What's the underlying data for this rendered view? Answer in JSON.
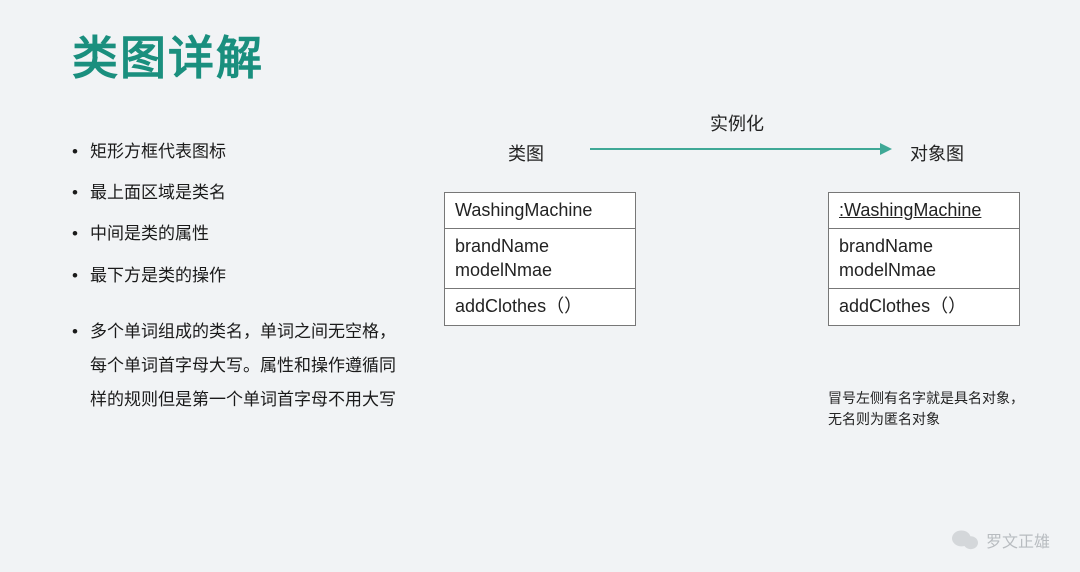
{
  "title": "类图详解",
  "bullets": [
    "矩形方框代表图标",
    "最上面区域是类名",
    "中间是类的属性",
    "最下方是类的操作"
  ],
  "bullet_long": "多个单词组成的类名，单词之间无空格，每个单词首字母大写。属性和操作遵循同样的规则但是第一个单词首字母不用大写",
  "labels": {
    "class": "类图",
    "instance": "实例化",
    "object": "对象图"
  },
  "class_box": {
    "name": "WashingMachine",
    "attr1": "brandName",
    "attr2": "modelNmae",
    "op": "addClothes（）"
  },
  "object_box": {
    "name": ":WashingMachine",
    "attr1": "brandName",
    "attr2": "modelNmae",
    "op": "addClothes（）"
  },
  "note_line1": "冒号左侧有名字就是具名对象，",
  "note_line2": "无名则为匿名对象",
  "watermark": "罗文正雄"
}
